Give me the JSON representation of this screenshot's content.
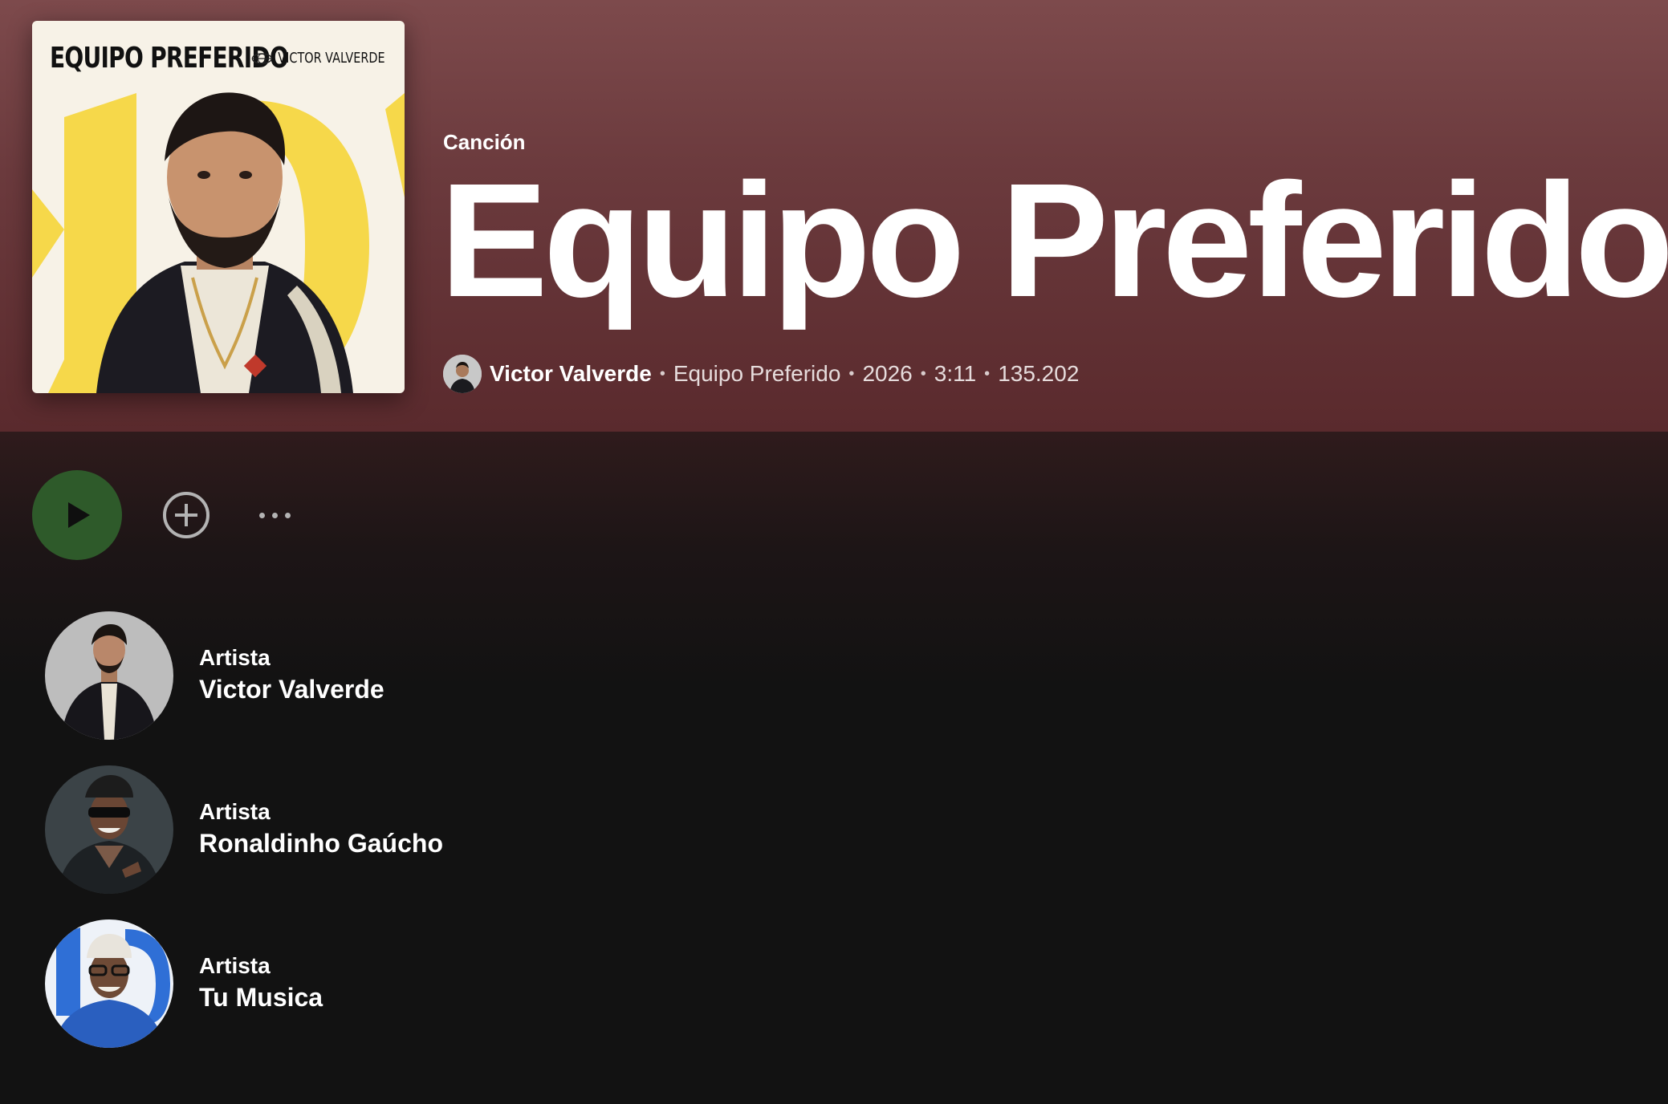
{
  "header": {
    "type_label": "Canción",
    "title": "Equipo Preferido",
    "cover": {
      "title": "EQUIPO PREFERIDO",
      "artist": "VICTOR VALVERDE"
    },
    "meta": {
      "artist": "Victor Valverde",
      "album": "Equipo Preferido",
      "year": "2026",
      "duration": "3:11",
      "plays": "135.202",
      "separator": "•"
    }
  },
  "actions": {
    "play_icon": "play-icon",
    "add_icon": "plus-circle-icon",
    "more_icon": "more-options-icon"
  },
  "artists": [
    {
      "kind": "Artista",
      "name": "Victor Valverde"
    },
    {
      "kind": "Artista",
      "name": "Ronaldinho Gaúcho"
    },
    {
      "kind": "Artista",
      "name": "Tu Musica"
    }
  ],
  "colors": {
    "hero_top": "#7d4a4c",
    "hero_bottom": "#5a2a2d",
    "background": "#121212",
    "play_button": "#2e5a2a"
  }
}
